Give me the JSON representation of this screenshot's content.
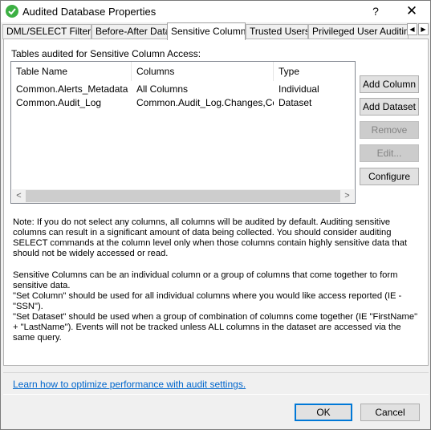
{
  "window": {
    "title": "Audited Database Properties",
    "help": "?",
    "close": "✕"
  },
  "tabs": [
    {
      "label": "DML/SELECT Filters",
      "active": false
    },
    {
      "label": "Before-After Data",
      "active": false
    },
    {
      "label": "Sensitive Columns",
      "active": true
    },
    {
      "label": "Trusted Users",
      "active": false
    },
    {
      "label": "Privileged User Auditing",
      "active": false
    }
  ],
  "tab_scroll": {
    "left": "◀",
    "right": "▶"
  },
  "group_label": "Tables audited for Sensitive Column Access:",
  "table": {
    "columns": [
      "Table Name",
      "Columns",
      "Type"
    ],
    "rows": [
      [
        "Common.Alerts_Metadata",
        "All Columns",
        "Individual"
      ],
      [
        "Common.Audit_Log",
        "Common.Audit_Log.Changes,Co...",
        "Dataset"
      ]
    ],
    "scroll_left": "<",
    "scroll_right": ">"
  },
  "buttons": {
    "add_column": "Add Column",
    "add_dataset": "Add Dataset",
    "remove": "Remove",
    "edit": "Edit...",
    "configure": "Configure"
  },
  "notes": {
    "p1": "Note: If you do not select any columns, all columns will be audited by default. Auditing sensitive columns can result in a significant amount of data being collected.  You should consider auditing SELECT commands at the column level only when those columns contain highly sensitive data that should not be widely accessed or read.",
    "p2": "Sensitive Columns can be an individual column or a group of columns that come together to form sensitive data.",
    "p3": "\"Set Column\" should be used for all individual columns where you would like access reported (IE - \"SSN\").",
    "p4": "\"Set Dataset\" should be used when a group of combination of columns come together (IE \"FirstName\" + \"LastName\"). Events will not be tracked unless ALL columns in the dataset are accessed via the same query."
  },
  "link": "Learn how to optimize performance with audit settings.",
  "footer": {
    "ok": "OK",
    "cancel": "Cancel"
  },
  "colors": {
    "app_icon": "#3cb043",
    "link": "#0066cc",
    "default_border": "#0078d7"
  }
}
